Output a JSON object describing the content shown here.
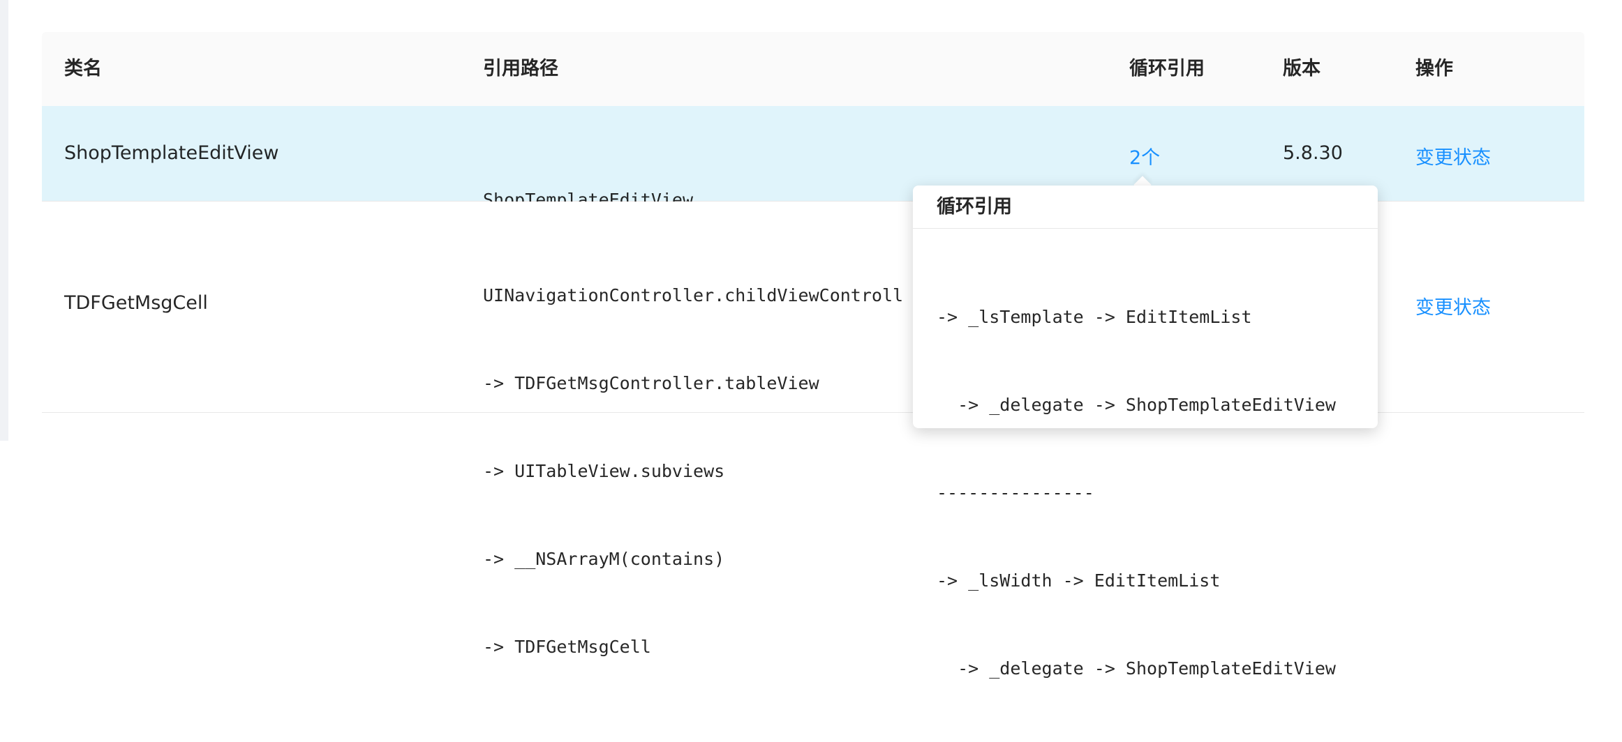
{
  "table": {
    "columns": {
      "class_name": "类名",
      "ref_path": "引用路径",
      "cycle_ref": "循环引用",
      "version": "版本",
      "action": "操作"
    },
    "rows": [
      {
        "class_name": "ShopTemplateEditView",
        "ref_path_lines": [
          "ShopTemplateEditView"
        ],
        "cycle_ref": "2个",
        "version": "5.8.30",
        "action": "变更状态"
      },
      {
        "class_name": "TDFGetMsgCell",
        "ref_path_lines": [
          "UINavigationController.childViewControll",
          "-> TDFGetMsgController.tableView",
          "-> UITableView.subviews",
          "-> __NSArrayM(contains)",
          "-> TDFGetMsgCell"
        ],
        "action": "变更状态"
      }
    ]
  },
  "popover": {
    "title": "循环引用",
    "lines": [
      "-> _lsTemplate -> EditItemList",
      "  -> _delegate -> ShopTemplateEditView",
      "---------------",
      "-> _lsWidth -> EditItemList",
      "  -> _delegate -> ShopTemplateEditView"
    ]
  },
  "colors": {
    "link": "#1890ff",
    "row_highlight": "#e0f4fb",
    "header_bg": "#fafafa"
  }
}
